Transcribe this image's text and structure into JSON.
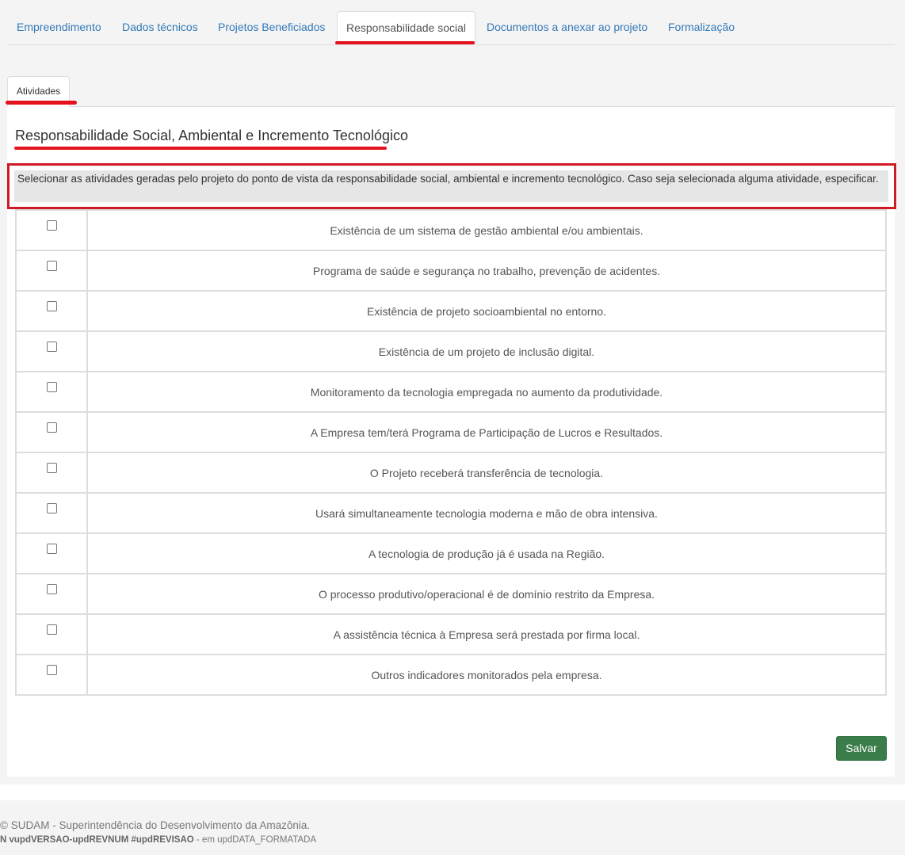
{
  "top_tabs": [
    {
      "label": "Empreendimento"
    },
    {
      "label": "Dados técnicos"
    },
    {
      "label": "Projetos Beneficiados"
    },
    {
      "label": "Responsabilidade social"
    },
    {
      "label": "Documentos a anexar ao projeto"
    },
    {
      "label": "Formalização"
    }
  ],
  "active_top_tab": "Responsabilidade social",
  "sub_tab": {
    "label": "Atividades"
  },
  "section": {
    "title": "Responsabilidade Social, Ambiental e Incremento Tecnológico",
    "instruction": "Selecionar as atividades geradas pelo projeto do ponto de vista da responsabilidade social, ambiental e incremento tecnológico. Caso seja selecionada alguma atividade, especificar."
  },
  "activities": [
    {
      "label": "Existência de um sistema de gestão ambiental e/ou ambientais.",
      "checked": false
    },
    {
      "label": "Programa de saúde e segurança no trabalho, prevenção de acidentes.",
      "checked": false
    },
    {
      "label": "Existência de projeto socioambiental no entorno.",
      "checked": false
    },
    {
      "label": "Existência de um projeto de inclusão digital.",
      "checked": false
    },
    {
      "label": "Monitoramento da tecnologia empregada no aumento da produtividade.",
      "checked": false
    },
    {
      "label": "A Empresa tem/terá Programa de Participação de Lucros e Resultados.",
      "checked": false
    },
    {
      "label": "O Projeto receberá transferência de tecnologia.",
      "checked": false
    },
    {
      "label": "Usará simultaneamente tecnologia moderna e mão de obra intensiva.",
      "checked": false
    },
    {
      "label": "A tecnologia de produção já é usada na Região.",
      "checked": false
    },
    {
      "label": "O processo produtivo/operacional é de domínio restrito da Empresa.",
      "checked": false
    },
    {
      "label": "A assistência técnica à Empresa será prestada por firma local.",
      "checked": false
    },
    {
      "label": "Outros indicadores monitorados pela empresa.",
      "checked": false
    }
  ],
  "save_label": "Salvar",
  "footer": {
    "line1": "© SUDAM - Superintendência do Desenvolvimento da Amazônia.",
    "version_bold": "N vupdVERSAO-updREVNUM #updREVISAO",
    "version_rest": " - em updDATA_FORMATADA"
  },
  "colors": {
    "link": "#337ab7",
    "annotation_red": "#e3121c",
    "save_button": "#3b7d4a",
    "instruction_bg": "#e6e6e6"
  }
}
